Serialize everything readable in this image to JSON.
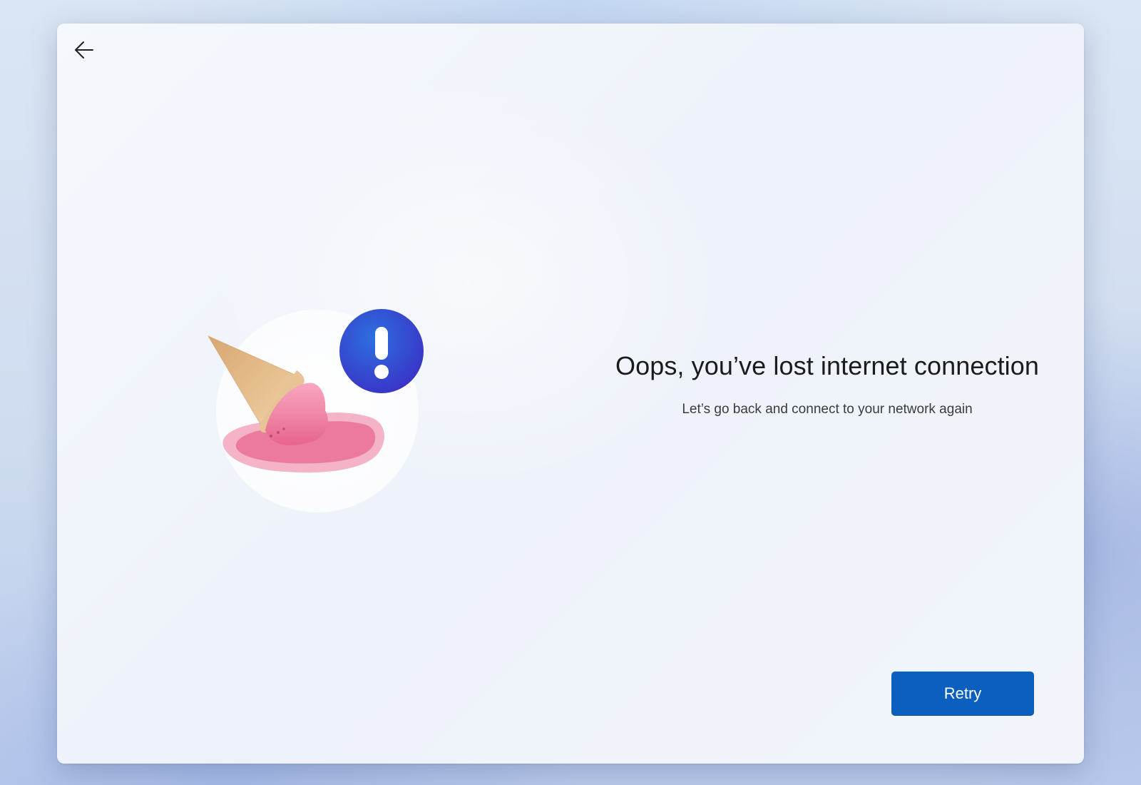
{
  "header": {
    "back_icon": "arrow-left-icon"
  },
  "illustration": {
    "description_icons": [
      "melted-ice-cream-icon",
      "exclamation-badge-icon"
    ],
    "badge_color": "#2f52d4",
    "drip_color": "#ef7da0"
  },
  "main": {
    "title": "Oops, you’ve lost internet connection",
    "subtitle": "Let’s go back and connect to your network again"
  },
  "footer": {
    "retry_label": "Retry",
    "accent_color": "#0a5fbf"
  }
}
